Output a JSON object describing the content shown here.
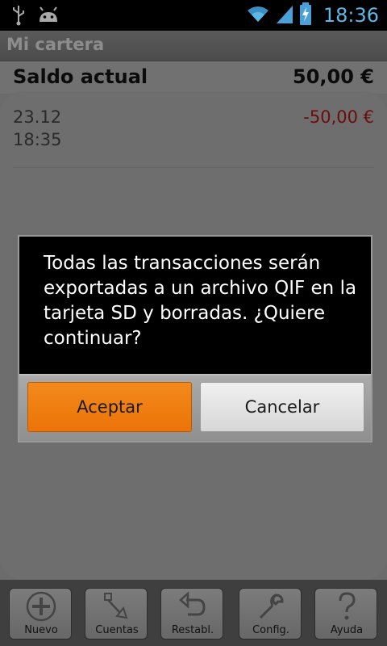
{
  "status_bar": {
    "time": "18:36",
    "icons": [
      "usb-icon",
      "android-debug-icon",
      "wifi-icon",
      "signal-icon",
      "battery-charging-icon"
    ]
  },
  "app": {
    "title": "Mi cartera"
  },
  "balance": {
    "label": "Saldo actual",
    "value": "50,00 €"
  },
  "transactions": [
    {
      "date": "23.12",
      "time": "18:35",
      "amount": "-50,00 €"
    }
  ],
  "dialog": {
    "message": "Todas las transacciones serán exportadas a un archivo QIF en la tarjeta SD y borradas. ¿Quiere continuar?",
    "accept_label": "Aceptar",
    "cancel_label": "Cancelar"
  },
  "toolbar": {
    "items": [
      {
        "label": "Nuevo",
        "icon": "add-icon"
      },
      {
        "label": "Cuentas",
        "icon": "accounts-icon"
      },
      {
        "label": "Restabl.",
        "icon": "undo-icon"
      },
      {
        "label": "Config.",
        "icon": "wrench-icon"
      },
      {
        "label": "Ayuda",
        "icon": "help-icon"
      }
    ]
  },
  "colors": {
    "accent": "#ec7308",
    "clock": "#5fb7e8",
    "negative_amount": "#6a0d0d"
  }
}
